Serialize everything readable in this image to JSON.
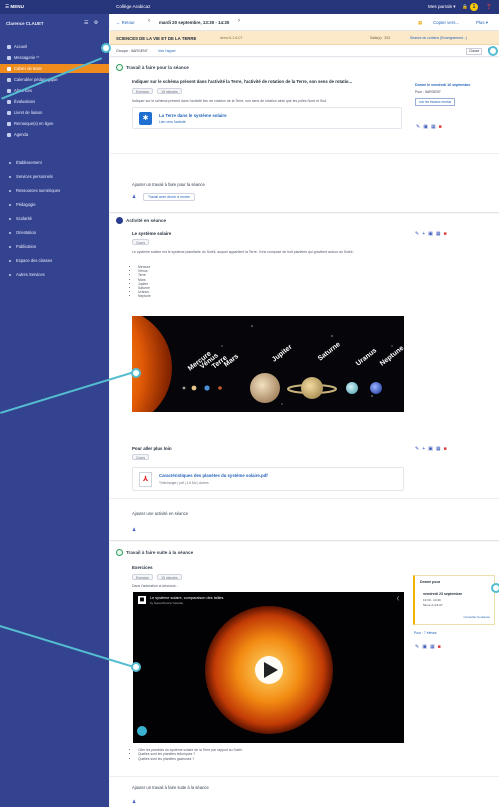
{
  "topbar": {
    "menu_label": "☰ MENU",
    "school": "Collège Arabicaz",
    "user_menu": "Mes parrals ▾",
    "badge": "1"
  },
  "sidebar": {
    "user": "Clarence CLAUET",
    "items": [
      {
        "label": "Accueil",
        "active": false,
        "group": false
      },
      {
        "label": "Messagerie ¹⁰",
        "active": false,
        "group": false
      },
      {
        "label": "Cahier de texte",
        "active": true,
        "group": false
      },
      {
        "label": "Calendrier pédagogique",
        "active": false,
        "group": false
      },
      {
        "label": "Absences",
        "active": false,
        "group": false
      },
      {
        "label": "Évaluations",
        "active": false,
        "group": false
      },
      {
        "label": "Livret de liaison",
        "active": false,
        "group": false
      },
      {
        "label": "Remarque(s) en ligne",
        "active": false,
        "group": false
      },
      {
        "label": "Agenda",
        "active": false,
        "group": false
      },
      {
        "label": "Établissement",
        "active": false,
        "group": true
      },
      {
        "label": "Services personnels",
        "active": false,
        "group": true
      },
      {
        "label": "Ressources numériques",
        "active": false,
        "group": true
      },
      {
        "label": "Pédagogie",
        "active": false,
        "group": true
      },
      {
        "label": "Scolarité",
        "active": false,
        "group": true
      },
      {
        "label": "Orientation",
        "active": false,
        "group": true
      },
      {
        "label": "Publication",
        "active": false,
        "group": true
      },
      {
        "label": "Espace des classes",
        "active": false,
        "group": true
      },
      {
        "label": "Autres Services",
        "active": false,
        "group": true
      }
    ]
  },
  "datebar": {
    "back": "← Retour",
    "prev": "‹",
    "date": "mardi 20 septembre, 13:30 - 14:30",
    "next": "›",
    "copy": "Copier vers...",
    "more": "Plus ▾"
  },
  "subject": {
    "title": "SCIENCES DE LA VIE ET DE LA TERRE",
    "room": "demo 6-2-6-07",
    "meta": "Salle(s) : 203",
    "link": "Séance du contenu (Enseignement...)"
  },
  "groupbar": {
    "group": "Groupe : 5ARGENT",
    "link": "Voir l'appel",
    "right": "Classe"
  },
  "section1": {
    "title": "Travail à faire pour la séance",
    "question": "Indiquer sur le schéma présent dans l'activité la Terre, l'activité de rotation de la Terre, son sens de rotatio...",
    "tags": [
      "Exercice",
      "15 minutes"
    ],
    "desc": "Indiquer sur le schéma présent dans l'activité lieu de rotation de la Terre, son sens de rotation ainsi que les pôles Nord et Sud.",
    "attachment_title": "La Terre dans le système solaire",
    "attachment_sub": "Lien vers l'activité",
    "due_label": "Donné le vendredi 16 septembre",
    "due_by": "Pour : 5ARGENT",
    "due_btn": "voir les travaux rendus",
    "add_title": "Ajouter un travail à faire pour la séance",
    "add_button": "Travail avec devoir à rendre"
  },
  "section2": {
    "title": "Activité en séance",
    "activity_title": "Le système solaire",
    "tag": "Cours",
    "intro": "Le système solaire est le système planétaire du Soleil, auquel appartient la Terre. Il est composé de huit planètes qui gravitent autour du Soleil :",
    "planets_list": [
      "Mercure",
      "Vénus",
      "Terre",
      "Mars",
      "Jupiter",
      "Saturne",
      "Uranus",
      "Neptune"
    ],
    "image_labels": [
      "Mercure",
      "Vénus",
      "Terre",
      "Mars",
      "Jupiter",
      "Saturne",
      "Uranus",
      "Neptune"
    ],
    "further_title": "Pour aller plus loin",
    "further_tag": "Cours",
    "pdf_title": "Caractéristiques des planètes du système solaire.pdf",
    "pdf_meta": "Télécharger | pdf | 1.6 Mo | Autres",
    "add_title": "Ajouter une activité en séance"
  },
  "section3": {
    "title": "Travail à faire suite à la séance",
    "exercise_title": "Exercices",
    "tags": [
      "Exercice",
      "15 minutes"
    ],
    "desc": "Dans l'animation ci-dessous :",
    "video_title": "Le système solaire, comparaison des tailles",
    "video_channel": "by Superchecca Youtube",
    "bullets": [
      "Citer les planètes du système solaire de la Terre par rapport au Soleil.",
      "Quelles sont les planètes telluriques ?",
      "Quelles sont les planètes gazeuses ?"
    ],
    "due_label": "Donné pour",
    "due_date": "vendredi 23 septembre",
    "due_time": "13:30 - 14:30",
    "due_room": "5ème 2-4-5-07",
    "due_link": "Consulter la séance",
    "due_for": "Pour : 7 élèves",
    "add_title": "Ajouter un travail à faire suite à la séance"
  }
}
